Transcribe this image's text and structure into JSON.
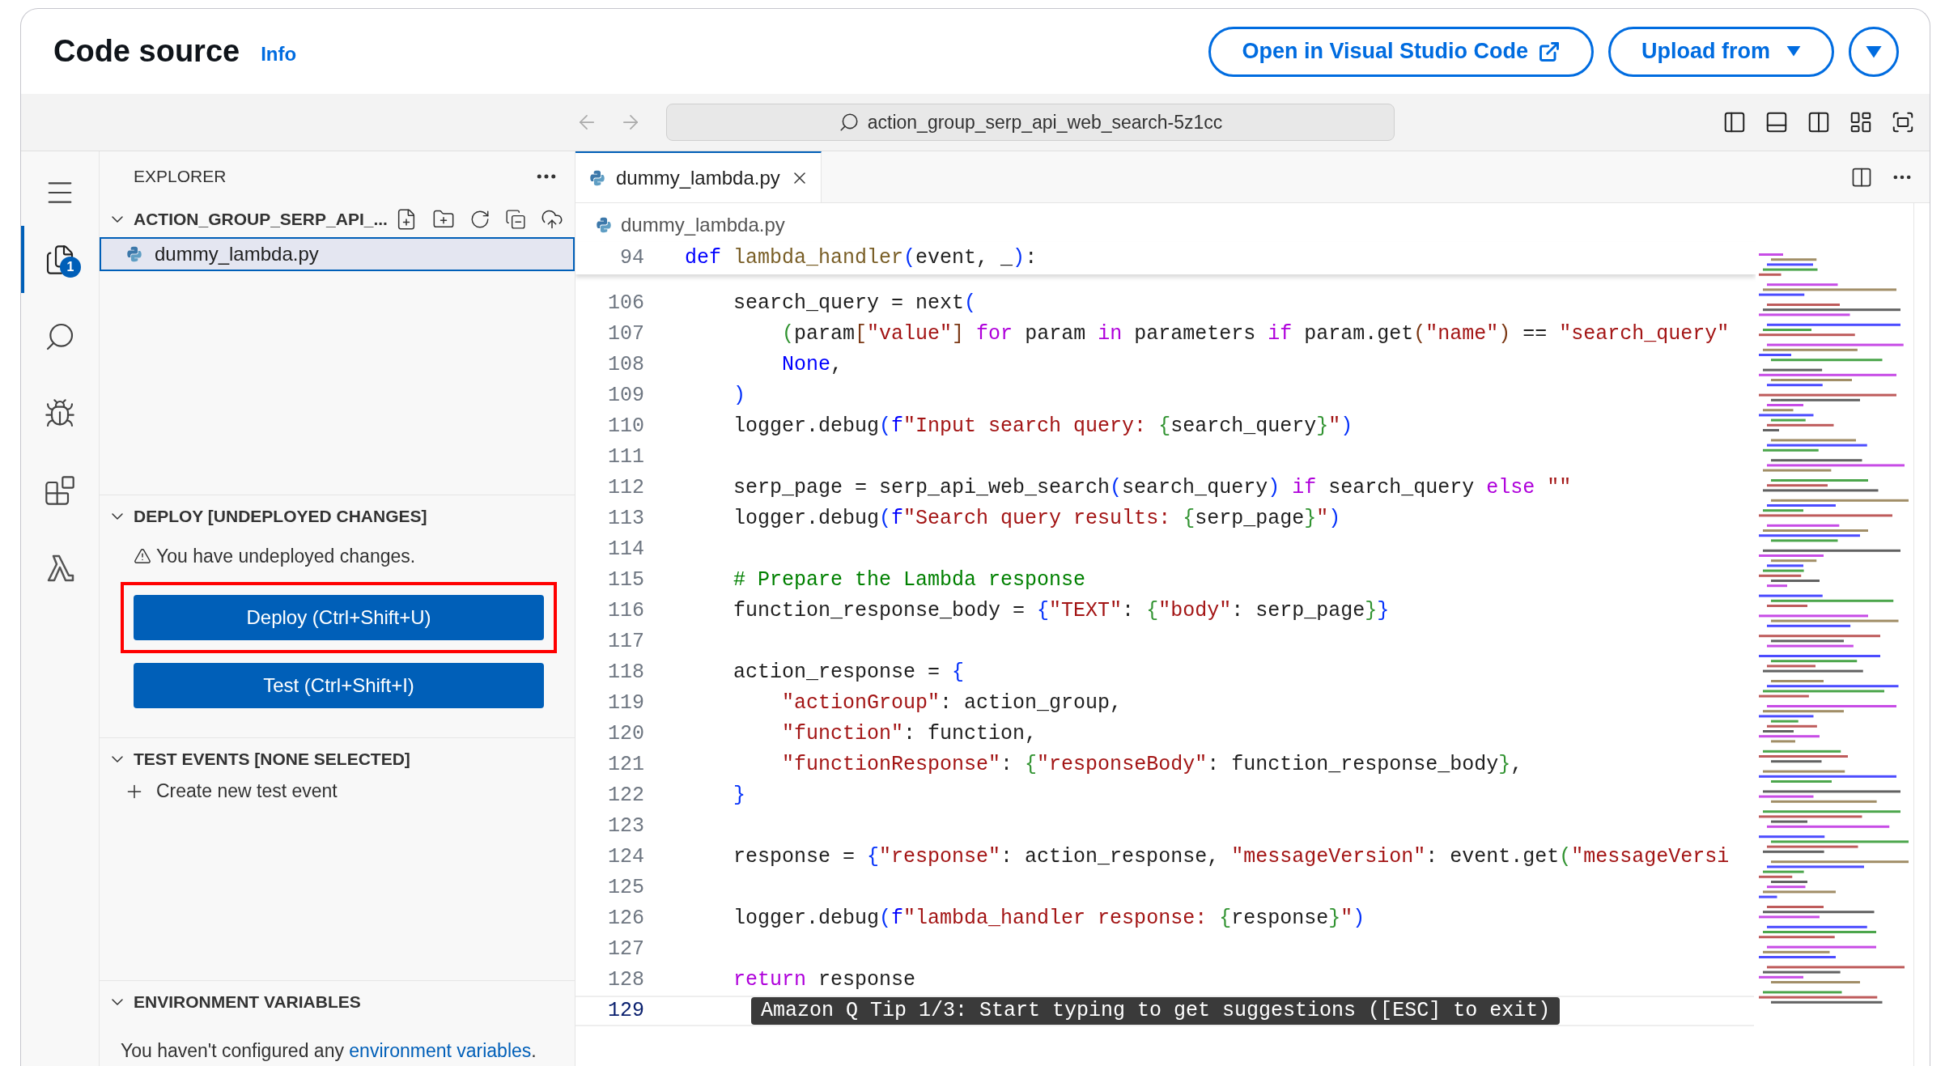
{
  "header": {
    "title": "Code source",
    "info_link": "Info",
    "buttons": [
      {
        "label": "Open in Visual Studio Code",
        "kind": "external"
      },
      {
        "label": "Upload from",
        "kind": "dropdown"
      }
    ]
  },
  "toolbar": {
    "search": "action_group_serp_api_web_search-5z1cc"
  },
  "activity_bar": [
    {
      "kind": "menu",
      "selected": false
    },
    {
      "kind": "explorer",
      "selected": true,
      "badge": "1"
    },
    {
      "kind": "search",
      "selected": false
    },
    {
      "kind": "debug",
      "selected": false
    },
    {
      "kind": "extensions",
      "selected": false
    },
    {
      "kind": "lambda",
      "selected": false
    }
  ],
  "explorer": {
    "title": "EXPLORER",
    "folder": {
      "name": "ACTION_GROUP_SERP_API_...",
      "expanded": true,
      "files": [
        {
          "name": "dummy_lambda.py",
          "selected": true
        }
      ]
    }
  },
  "deploy": {
    "title": "DEPLOY [UNDEPLOYED CHANGES]",
    "expanded": true,
    "warning": "You have undeployed changes.",
    "buttons": [
      {
        "label": "Deploy (Ctrl+Shift+U)",
        "highlighted": true
      },
      {
        "label": "Test (Ctrl+Shift+I)",
        "highlighted": false
      }
    ]
  },
  "test_events": {
    "title": "TEST EVENTS [NONE SELECTED]",
    "expanded": true,
    "action": "Create new test event"
  },
  "environment_variables": {
    "title": "ENVIRONMENT VARIABLES",
    "expanded": true,
    "text": "You haven't configured any",
    "link": "environment variables",
    "text_end": "."
  },
  "editor": {
    "tabs": [
      {
        "label": "dummy_lambda.py",
        "selected": true
      }
    ],
    "breadcrumb": "dummy_lambda.py",
    "sticky_line": {
      "number": "94",
      "tokens": [
        {
          "kind": "keyword",
          "text": "def "
        },
        {
          "kind": "function",
          "text": "lambda_handler"
        },
        {
          "kind": "bracket1",
          "text": "("
        },
        {
          "kind": "plain",
          "text": "event, _"
        },
        {
          "kind": "bracket1",
          "text": ")"
        },
        {
          "kind": "plain",
          "text": ":"
        }
      ]
    },
    "lines": [
      {
        "number": "106",
        "tokens": [
          {
            "kind": "plain",
            "text": "    search_query = next"
          },
          {
            "kind": "bracket1",
            "text": "("
          }
        ]
      },
      {
        "number": "107",
        "tokens": [
          {
            "kind": "bracket2",
            "text": "        ("
          },
          {
            "kind": "plain",
            "text": "param"
          },
          {
            "kind": "bracket3",
            "text": "["
          },
          {
            "kind": "string",
            "text": "\"value\""
          },
          {
            "kind": "bracket3",
            "text": "]"
          },
          {
            "kind": "control",
            "text": " for"
          },
          {
            "kind": "plain",
            "text": " param "
          },
          {
            "kind": "control",
            "text": "in"
          },
          {
            "kind": "plain",
            "text": " parameters "
          },
          {
            "kind": "control",
            "text": "if"
          },
          {
            "kind": "plain",
            "text": " param.get"
          },
          {
            "kind": "bracket3",
            "text": "("
          },
          {
            "kind": "string",
            "text": "\"name\""
          },
          {
            "kind": "bracket3",
            "text": ")"
          },
          {
            "kind": "plain",
            "text": " == "
          },
          {
            "kind": "string",
            "text": "\"search_query\""
          }
        ]
      },
      {
        "number": "108",
        "tokens": [
          {
            "kind": "keyword",
            "text": "        None"
          },
          {
            "kind": "plain",
            "text": ","
          }
        ]
      },
      {
        "number": "109",
        "tokens": [
          {
            "kind": "bracket1",
            "text": "    )"
          }
        ]
      },
      {
        "number": "110",
        "tokens": [
          {
            "kind": "plain",
            "text": "    logger.debug"
          },
          {
            "kind": "bracket1",
            "text": "("
          },
          {
            "kind": "keyword",
            "text": "f"
          },
          {
            "kind": "string",
            "text": "\"Input search query: "
          },
          {
            "kind": "bracket2",
            "text": "{"
          },
          {
            "kind": "plain",
            "text": "search_query"
          },
          {
            "kind": "bracket2",
            "text": "}"
          },
          {
            "kind": "string",
            "text": "\""
          },
          {
            "kind": "bracket1",
            "text": ")"
          }
        ]
      },
      {
        "number": "111"
      },
      {
        "number": "112",
        "tokens": [
          {
            "kind": "plain",
            "text": "    serp_page = serp_api_web_search"
          },
          {
            "kind": "bracket1",
            "text": "("
          },
          {
            "kind": "plain",
            "text": "search_query"
          },
          {
            "kind": "bracket1",
            "text": ")"
          },
          {
            "kind": "control",
            "text": " if"
          },
          {
            "kind": "plain",
            "text": " search_query "
          },
          {
            "kind": "control",
            "text": "else"
          },
          {
            "kind": "string",
            "text": " \"\""
          }
        ]
      },
      {
        "number": "113",
        "tokens": [
          {
            "kind": "plain",
            "text": "    logger.debug"
          },
          {
            "kind": "bracket1",
            "text": "("
          },
          {
            "kind": "keyword",
            "text": "f"
          },
          {
            "kind": "string",
            "text": "\"Search query results: "
          },
          {
            "kind": "bracket2",
            "text": "{"
          },
          {
            "kind": "plain",
            "text": "serp_page"
          },
          {
            "kind": "bracket2",
            "text": "}"
          },
          {
            "kind": "string",
            "text": "\""
          },
          {
            "kind": "bracket1",
            "text": ")"
          }
        ]
      },
      {
        "number": "114"
      },
      {
        "number": "115",
        "tokens": [
          {
            "kind": "comment",
            "text": "    # Prepare the Lambda response"
          }
        ]
      },
      {
        "number": "116",
        "tokens": [
          {
            "kind": "plain",
            "text": "    function_response_body = "
          },
          {
            "kind": "bracket1",
            "text": "{"
          },
          {
            "kind": "string",
            "text": "\"TEXT\""
          },
          {
            "kind": "plain",
            "text": ": "
          },
          {
            "kind": "bracket2",
            "text": "{"
          },
          {
            "kind": "string",
            "text": "\"body\""
          },
          {
            "kind": "plain",
            "text": ": serp_page"
          },
          {
            "kind": "bracket2",
            "text": "}"
          },
          {
            "kind": "bracket1",
            "text": "}"
          }
        ]
      },
      {
        "number": "117"
      },
      {
        "number": "118",
        "tokens": [
          {
            "kind": "plain",
            "text": "    action_response = "
          },
          {
            "kind": "bracket1",
            "text": "{"
          }
        ]
      },
      {
        "number": "119",
        "tokens": [
          {
            "kind": "string",
            "text": "        \"actionGroup\""
          },
          {
            "kind": "plain",
            "text": ": action_group,"
          }
        ]
      },
      {
        "number": "120",
        "tokens": [
          {
            "kind": "string",
            "text": "        \"function\""
          },
          {
            "kind": "plain",
            "text": ": function,"
          }
        ]
      },
      {
        "number": "121",
        "tokens": [
          {
            "kind": "string",
            "text": "        \"functionResponse\""
          },
          {
            "kind": "plain",
            "text": ": "
          },
          {
            "kind": "bracket2",
            "text": "{"
          },
          {
            "kind": "string",
            "text": "\"responseBody\""
          },
          {
            "kind": "plain",
            "text": ": function_response_body"
          },
          {
            "kind": "bracket2",
            "text": "}"
          },
          {
            "kind": "plain",
            "text": ","
          }
        ]
      },
      {
        "number": "122",
        "tokens": [
          {
            "kind": "bracket1",
            "text": "    }"
          }
        ]
      },
      {
        "number": "123"
      },
      {
        "number": "124",
        "tokens": [
          {
            "kind": "plain",
            "text": "    response = "
          },
          {
            "kind": "bracket1",
            "text": "{"
          },
          {
            "kind": "string",
            "text": "\"response\""
          },
          {
            "kind": "plain",
            "text": ": action_response, "
          },
          {
            "kind": "string",
            "text": "\"messageVersion\""
          },
          {
            "kind": "plain",
            "text": ": event.get"
          },
          {
            "kind": "bracket2",
            "text": "("
          },
          {
            "kind": "string",
            "text": "\"messageVersi"
          }
        ]
      },
      {
        "number": "125"
      },
      {
        "number": "126",
        "tokens": [
          {
            "kind": "plain",
            "text": "    logger.debug"
          },
          {
            "kind": "bracket1",
            "text": "("
          },
          {
            "kind": "keyword",
            "text": "f"
          },
          {
            "kind": "string",
            "text": "\"lambda_handler response: "
          },
          {
            "kind": "bracket2",
            "text": "{"
          },
          {
            "kind": "plain",
            "text": "response"
          },
          {
            "kind": "bracket2",
            "text": "}"
          },
          {
            "kind": "string",
            "text": "\""
          },
          {
            "kind": "bracket1",
            "text": ")"
          }
        ]
      },
      {
        "number": "127"
      },
      {
        "number": "128",
        "tokens": [
          {
            "kind": "control",
            "text": "    return"
          },
          {
            "kind": "plain",
            "text": " response"
          }
        ]
      }
    ],
    "current_line": {
      "number": "129"
    },
    "hint": "Amazon Q Tip 1/3: Start typing to get suggestions ([ESC] to exit)"
  }
}
